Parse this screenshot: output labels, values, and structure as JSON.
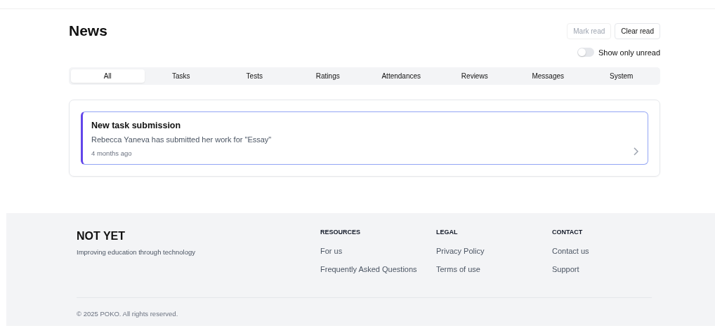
{
  "page": {
    "title": "News"
  },
  "actions": [
    {
      "label": "Mark read",
      "disabled": true
    },
    {
      "label": "Clear read",
      "disabled": false
    }
  ],
  "filter_toggle": {
    "label": "Show only unread",
    "on": false
  },
  "tabs": [
    {
      "label": "All",
      "selected": true
    },
    {
      "label": "Tasks",
      "selected": false
    },
    {
      "label": "Tests",
      "selected": false
    },
    {
      "label": "Ratings",
      "selected": false
    },
    {
      "label": "Attendances",
      "selected": false
    },
    {
      "label": "Reviews",
      "selected": false
    },
    {
      "label": "Messages",
      "selected": false
    },
    {
      "label": "System",
      "selected": false
    }
  ],
  "notifications": [
    {
      "title": "New task submission",
      "body": "Rebecca Yaneva has submitted her work for \"Essay\"",
      "time": "4 months ago",
      "unread": true
    }
  ],
  "footer": {
    "brand": "NOT YET",
    "tagline": "Improving education through technology",
    "columns": [
      {
        "heading": "RESOURCES",
        "links": [
          "For us",
          "Frequently Asked Questions"
        ]
      },
      {
        "heading": "LEGAL",
        "links": [
          "Privacy Policy",
          "Terms of use"
        ]
      },
      {
        "heading": "CONTACT",
        "links": [
          "Contact us",
          "Support"
        ]
      }
    ],
    "copyright": "© 2025 POKO. All rights reserved."
  }
}
